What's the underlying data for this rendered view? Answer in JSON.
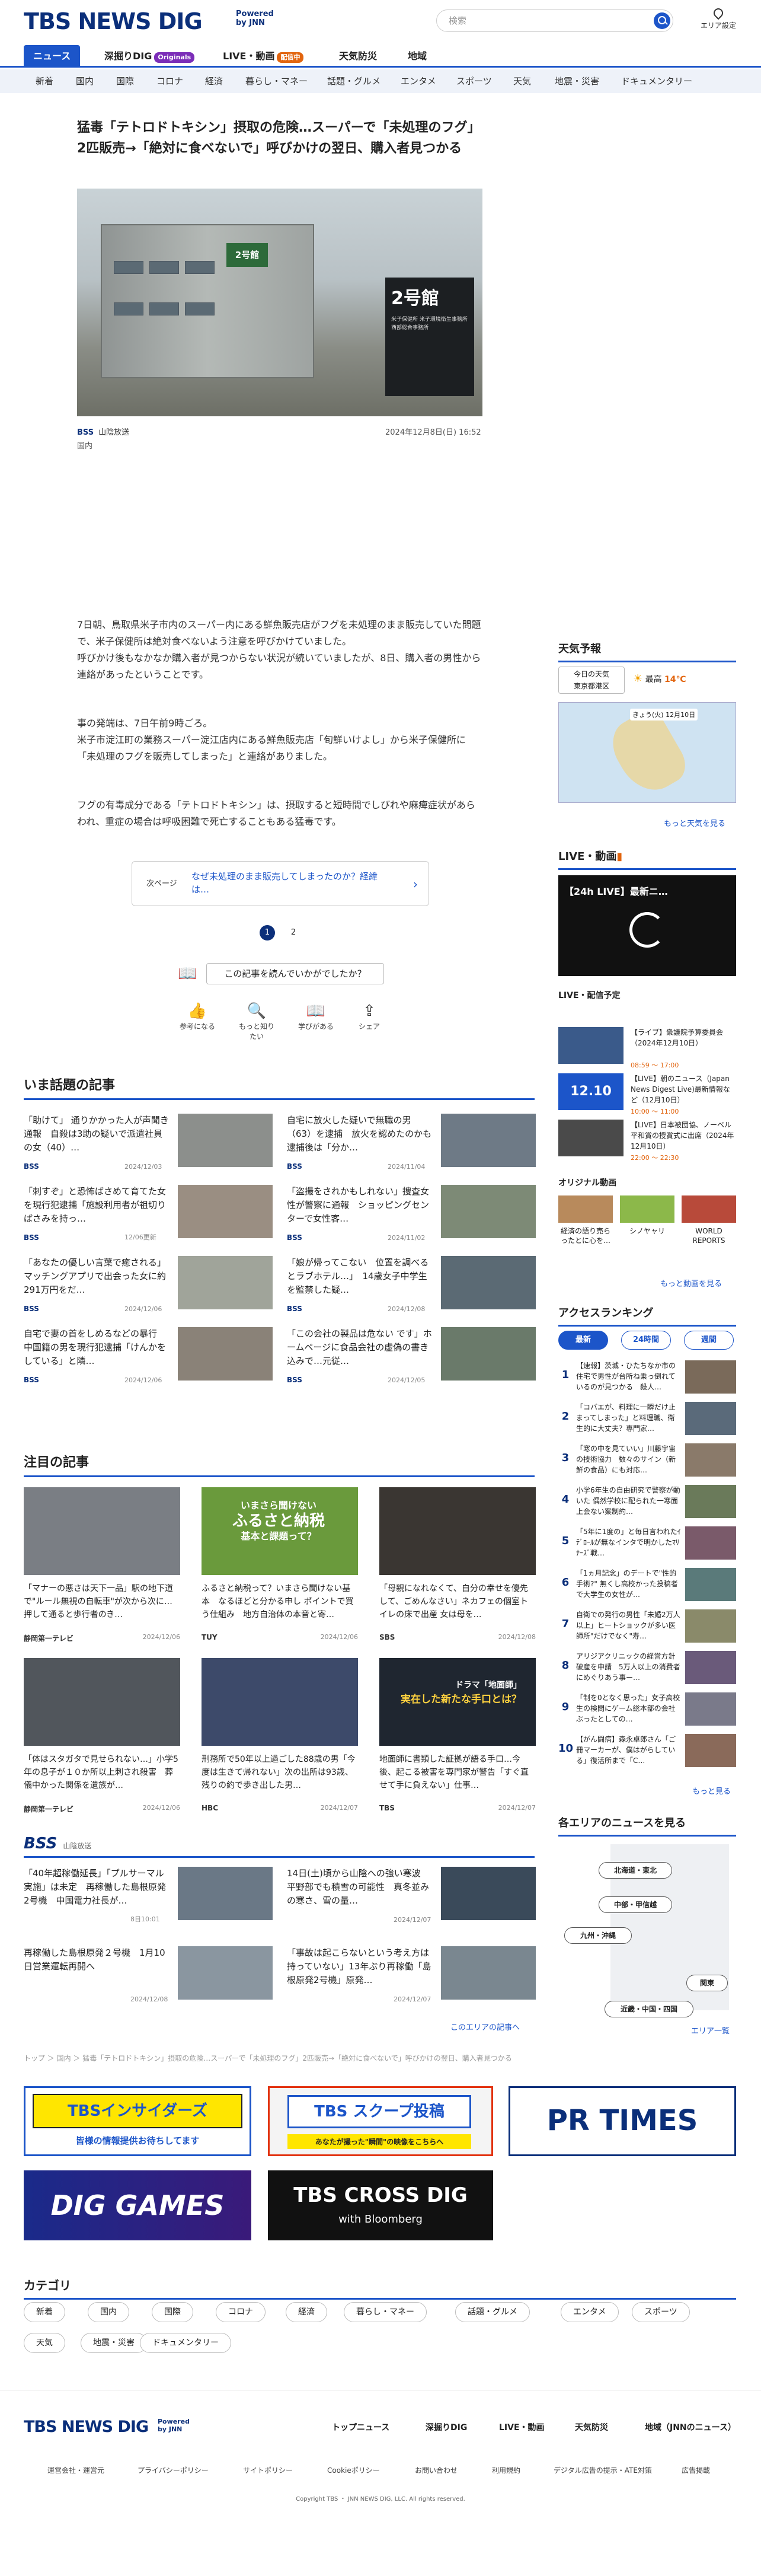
{
  "header": {
    "logo": "TBS NEWS DIG",
    "powered": "Powered by JNN",
    "search_placeholder": "検索",
    "area_setting": "エリア設定"
  },
  "nav_main": [
    {
      "label": "ニュース"
    },
    {
      "label": "深掘りDIG",
      "badge": "Originals"
    },
    {
      "label": "LIVE・動画",
      "badge": "配信中"
    },
    {
      "label": "天気防災"
    },
    {
      "label": "地域"
    }
  ],
  "nav_sub": [
    "新着",
    "国内",
    "国際",
    "コロナ",
    "経済",
    "暮らし・マネー",
    "話題・グルメ",
    "エンタメ",
    "スポーツ",
    "天気",
    "地震・災害",
    "ドキュメンタリー"
  ],
  "article": {
    "title": "猛毒「テトロドトキシン」摂取の危険…スーパーで「未処理のフグ」2匹販売→「絶対に食べないで」呼びかけの翌日、購入者見つかる",
    "photo_sign_big": "2号館",
    "photo_sign_small": "米子保健所 米子環境衛生事務所 西部総合事務所",
    "photo_bldg_label": "2号館",
    "source_logo": "BSS",
    "source": "山陰放送",
    "date": "2024年12月8日(日) 16:52",
    "category": "国内",
    "paragraphs": [
      "7日朝、鳥取県米子市内のスーパー内にある鮮魚販売店がフグを未処理のまま販売していた問題で、米子保健所は絶対食べないよう注意を呼びかけていました。",
      "呼びかけ後もなかなか購入者が見つからない状況が続いていましたが、8日、購入者の男性から連絡があったということです。",
      "事の発端は、7日午前9時ごろ。",
      "米子市淀江町の業務スーパー淀江店内にある鮮魚販売店「旬鮮いけよし」から米子保健所に「未処理のフグを販売してしまった」と連絡がありました。",
      "フグの有毒成分である「テトロドトキシン」は、摂取すると短時間でしびれや麻痺症状があらわれ、重症の場合は呼吸困難で死亡することもある猛毒です。"
    ],
    "next_label": "次ページ",
    "next_text": "なぜ未処理のまま販売してしまったのか？経緯は…",
    "pages": [
      "1",
      "2"
    ],
    "feedback_q": "この記事を読んでいかがでしたか？",
    "reactions": [
      "参考になる",
      "もっと知りたい",
      "学びがある",
      "シェア"
    ]
  },
  "trending": {
    "title": "いま話題の記事",
    "items": [
      {
        "title": "「助けて」 通りかかった人が声聞き通報　自殺は3助の疑いで派遣社員の女（40）…",
        "src": "BSS",
        "date": "2024/12/03"
      },
      {
        "title": "自宅に放火した疑いで無職の男（63）を逮捕　放火を認めたのかも逮捕後は「分か…",
        "src": "BSS",
        "date": "2024/11/04"
      },
      {
        "title": "「刺すぞ」と恐怖ばさめて育てた女を現行犯逮捕「施設利用者が祖切りばさみを持っ…",
        "src": "BSS",
        "date": "12/06更新"
      },
      {
        "title": "「盗撮をされかもしれない」捜査女性が警察に通報　ショッピングセンターで女性客…",
        "src": "BSS",
        "date": "2024/11/02"
      },
      {
        "title": "「あなたの優しい言葉で癒される」マッチングアプリで出会った女に約291万円をだ…",
        "src": "BSS",
        "date": "2024/12/06"
      },
      {
        "title": "「娘が帰ってこない　位置を調べるとラブホテル…」　14歳女子中学生を監禁した疑…",
        "src": "BSS",
        "date": "2024/12/08"
      },
      {
        "title": "自宅で妻の首をしめるなどの暴行　中国籍の男を現行犯逮捕「けんかをしている」と隣…",
        "src": "BSS",
        "date": "2024/12/06"
      },
      {
        "title": "「この会社の製品は危ない です」ホームページに食品会社の虚偽の書き込みで…元従…",
        "src": "BSS",
        "date": "2024/12/05"
      }
    ]
  },
  "featured": {
    "title": "注目の記事",
    "items": [
      {
        "title": "「マナーの悪さは天下一品」駅の地下道で\"ルール無視の自転車\"が次から次に…押して通ると歩行者のき…",
        "src": "静岡第一テレビ",
        "date": "2024/12/06",
        "img": "#7a7e84"
      },
      {
        "title": "ふるさと納税って？いまさら聞けない基本　なるほどと分かる申し  ポイントで買う仕組み　地方自治体の本音と寄…",
        "src": "TUY",
        "date": "2024/12/06",
        "img": "#6a9a3c"
      },
      {
        "title": "「母親になれなくて、自分の幸せを優先して、ごめんなさい」ネカフェの個室トイレの床で出産 女は母を…",
        "src": "SBS",
        "date": "2024/12/08",
        "img": "#3a3632"
      },
      {
        "title": "「体はスタガタで見せられない…」小学5年の息子が１０か所以上刺され殺害　葬儀中かった関係を遺族が…",
        "src": "静岡第一テレビ",
        "date": "2024/12/06",
        "img": "#51565c"
      },
      {
        "title": "刑務所で50年以上過ごした88歳の男「今度は生きて帰れない」次の出所は93歳、残りの約で歩き出した男…",
        "src": "HBC",
        "date": "2024/12/07",
        "img": "#3d4a6a"
      },
      {
        "title": "地面師に書類した証拠が語る手口…今後、起こる被害を専門家が警告「すぐ直せて手に負えない」仕事…",
        "src": "TBS",
        "date": "2024/12/07",
        "img": "#1f2630"
      }
    ]
  },
  "featured_overlay": {
    "f2a": "いまさら聞けない",
    "f2b": "ふるさと納税",
    "f2c": "基本と課題って？",
    "f6a": "ドラマ「地面師」",
    "f6b": "実在した新たな手口とは？"
  },
  "bss": {
    "logo": "BSS",
    "name": "山陰放送",
    "items": [
      {
        "title": "「40年超稼働延長」「プルサーマル実施」は未定　再稼働した島根原発2号機　中国電力社長が…",
        "date": "8日10:01"
      },
      {
        "title": "14日(土)頃から山陰への強い寒波　平野部でも積雪の可能性　真冬並みの寒さ、雪の量…",
        "date": "2024/12/07"
      },
      {
        "title": "再稼働した島根原発２号機　1月10日営業運転再開へ",
        "date": "2024/12/08"
      },
      {
        "title": "「事故は起こらないという考え方は持っていない」13年ぶり再稼働「島根原発2号機」原発…",
        "date": "2024/12/07"
      }
    ],
    "more": "このエリアの記事へ"
  },
  "sidebar": {
    "weather_title": "天気予報",
    "wx_pill_a": "今日の天気",
    "wx_pill_b": "東京都港区",
    "wx_label": "最高",
    "wx_temp": "14℃",
    "wx_more": "もっと天気を見る",
    "wx_map_label": "きょう(火) 12月10日",
    "live_title": "LIVE・動画",
    "live_video": "【24h LIVE】最新ニ…",
    "live_schedule": "LIVE・配信予定",
    "live_items": [
      {
        "title": "【ライブ】衆議院予算委員会（2024年12月10日）",
        "time": "08:59 〜 17:00"
      },
      {
        "title": "【LIVE】朝のニュース（Japan News Digest Live)最新情報など（12月10日）",
        "time": "10:00 〜 11:00"
      },
      {
        "title": "【LIVE】日本被団協、ノーベル平和賞の授賞式に出席（2024年12月10日）",
        "time": "22:00 〜 22:30"
      }
    ],
    "live_thumb_date": "12.10",
    "orig_title": "オリジナル動画",
    "originals": [
      "経済の語り売らったとに心を…",
      "シノヤャリ",
      "WORLD REPORTS"
    ],
    "live_more": "もっと動画を見る",
    "rank_title": "アクセスランキング",
    "rank_tabs": [
      "最新",
      "24時間",
      "週間"
    ],
    "ranks": [
      {
        "n": "1",
        "t": "【速報】茨城・ひたちなか市の住宅で男性が台所ね乗っ倒れているのが見つかる　殺人…"
      },
      {
        "n": "2",
        "t": "「コバエが、料理に一瞬だけ止まってしまった」と料理職、衛生的に大丈夫？専門家…"
      },
      {
        "n": "3",
        "t": "「寒の中を見ていい」川藤宇宙の技術協力　数々のサイン（新鮮の食品）にも対応…"
      },
      {
        "n": "4",
        "t": "小学6年生の自由研究で警察が動いた 偶然学校に配られた一寒面上会ない案制約…"
      },
      {
        "n": "5",
        "t": "「5年に1度の」と毎日言われたｲﾃﾞﾛｰﾙが無なインタで明かしたﾏﾘﾅｰｽﾞ戦…"
      },
      {
        "n": "6",
        "t": "「1ヵ月記念」のデートで\"性的手術?\" 無くし高校かった投稿者で大学生の女性が…"
      },
      {
        "n": "7",
        "t": "自衛での発行の男性「未婚2万人以上」ヒートショックが多い医師所\"だけでなく\"寿…"
      },
      {
        "n": "8",
        "t": "アリジアクリニックの経営方針破産を申請　5万人以上の消費者にめぐりあう事ー…"
      },
      {
        "n": "9",
        "t": "「制を0となく思った」女子高校生の検問にゲーム総本部の会社ぶったとしての…"
      },
      {
        "n": "10",
        "t": "【がん闘病】森永卓郎さん「ご冊マーカーが、僕はがらしている」復活所まで「C…"
      }
    ],
    "rank_more": "もっと見る",
    "area_title": "各エリアのニュースを見る",
    "areas": [
      "北海道・東北",
      "中部・甲信越",
      "九州・沖縄",
      "関東",
      "近畿・中国・四国"
    ],
    "area_more": "エリア一覧"
  },
  "breadcrumb": "トップ ＞ 国内 ＞ 猛毒「テトロドトキシン」摂取の危険…スーパーで「未処理のフグ」2匹販売→「絶対に食べないで」呼びかけの翌日、購入者見つかる",
  "banners": {
    "insiders": "TBSインサイダーズ",
    "insiders_sub": "皆様の情報提供お待ちしてます",
    "scoop": "TBS スクープ投稿",
    "scoop_sub": "あなたが撮った\"瞬間\"の映像をこちらへ",
    "prtimes": "PR TIMES",
    "diggames": "DIG GAMES",
    "crossdig": "TBS CROSS DIG",
    "crossdig_sub": "with Bloomberg"
  },
  "categories": {
    "title": "カテゴリ",
    "items": [
      "新着",
      "国内",
      "国際",
      "コロナ",
      "経済",
      "暮らし・マネー",
      "話題・グルメ",
      "エンタメ",
      "スポーツ",
      "天気",
      "地震・災害",
      "ドキュメンタリー"
    ]
  },
  "footer": {
    "logo": "TBS NEWS DIG",
    "powered": "Powered by JNN",
    "nav": [
      "トップニュース",
      "深掘りDIG",
      "LIVE・動画",
      "天気防災",
      "地域（JNNのニュース）"
    ],
    "sub": [
      "運営会社・運営元",
      "プライバシーポリシー",
      "サイトポリシー",
      "Cookieポリシー",
      "お問い合わせ",
      "利用規約",
      "デジタル広告の提示・ATE対策",
      "広告掲載"
    ],
    "copyright": "Copyright TBS ・ JNN NEWS DIG, LLC. All rights reserved."
  }
}
